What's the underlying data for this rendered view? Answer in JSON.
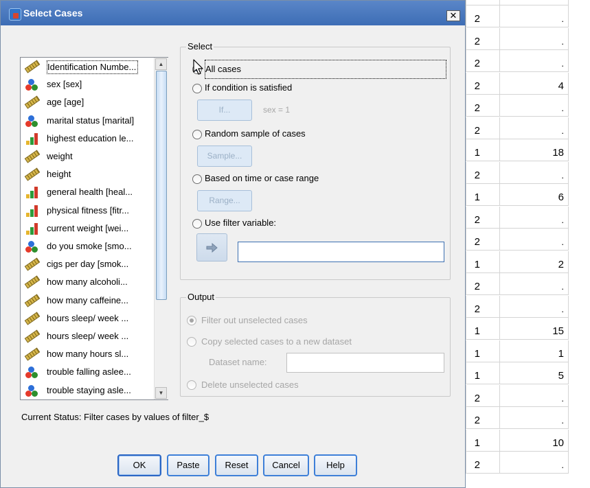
{
  "window": {
    "title": "Select Cases",
    "close_glyph": "✕"
  },
  "variables": [
    {
      "label": "Identification Numbe...",
      "icon": "scale-icon"
    },
    {
      "label": "sex [sex]",
      "icon": "nominal-icon"
    },
    {
      "label": "age [age]",
      "icon": "scale-icon"
    },
    {
      "label": "marital status [marital]",
      "icon": "nominal-icon"
    },
    {
      "label": "highest education le...",
      "icon": "ordinal-icon"
    },
    {
      "label": "weight",
      "icon": "scale-icon"
    },
    {
      "label": "height",
      "icon": "scale-icon"
    },
    {
      "label": "general health [heal...",
      "icon": "ordinal-icon"
    },
    {
      "label": "physical fitness [fitr...",
      "icon": "ordinal-icon"
    },
    {
      "label": "current weight [wei...",
      "icon": "ordinal-icon"
    },
    {
      "label": "do you smoke [smo...",
      "icon": "nominal-icon"
    },
    {
      "label": "cigs per day  [smok...",
      "icon": "scale-icon"
    },
    {
      "label": "how  many alcoholi...",
      "icon": "scale-icon"
    },
    {
      "label": "how many caffeine...",
      "icon": "scale-icon"
    },
    {
      "label": "hours sleep/ week ...",
      "icon": "scale-icon"
    },
    {
      "label": "hours sleep/ week ...",
      "icon": "scale-icon"
    },
    {
      "label": "how many hours sl...",
      "icon": "scale-icon"
    },
    {
      "label": "trouble falling aslee...",
      "icon": "nominal-icon"
    },
    {
      "label": "trouble staying asle...",
      "icon": "nominal-icon"
    }
  ],
  "select": {
    "group_title": "Select",
    "all_cases": "All cases",
    "if_condition": "If condition is satisfied",
    "if_button": "If...",
    "if_expression": "sex = 1",
    "random_sample": "Random sample of cases",
    "sample_button": "Sample...",
    "based_on_time": "Based on time or case range",
    "range_button": "Range...",
    "use_filter": "Use filter variable:",
    "filter_value": "",
    "selected_option": "All cases"
  },
  "output": {
    "group_title": "Output",
    "filter_out": "Filter out unselected cases",
    "copy_selected": "Copy selected cases to a new dataset",
    "dataset_name_label": "Dataset name:",
    "dataset_name_value": "",
    "delete_unselected": "Delete unselected cases"
  },
  "status": "Current Status: Filter cases by values of filter_$",
  "buttons": {
    "ok": "OK",
    "paste": "Paste",
    "reset": "Reset",
    "cancel": "Cancel",
    "help": "Help"
  },
  "sheet_rows": [
    {
      "a": "2",
      "b": "."
    },
    {
      "a": "2",
      "b": "."
    },
    {
      "a": "2",
      "b": "."
    },
    {
      "a": "2",
      "b": "4"
    },
    {
      "a": "2",
      "b": "."
    },
    {
      "a": "2",
      "b": "."
    },
    {
      "a": "1",
      "b": "18"
    },
    {
      "a": "2",
      "b": "."
    },
    {
      "a": "1",
      "b": "6"
    },
    {
      "a": "2",
      "b": "."
    },
    {
      "a": "2",
      "b": "."
    },
    {
      "a": "1",
      "b": "2"
    },
    {
      "a": "2",
      "b": "."
    },
    {
      "a": "2",
      "b": "."
    },
    {
      "a": "1",
      "b": "15"
    },
    {
      "a": "1",
      "b": "1"
    },
    {
      "a": "1",
      "b": "5"
    },
    {
      "a": "2",
      "b": "."
    },
    {
      "a": "2",
      "b": "."
    },
    {
      "a": "1",
      "b": "10"
    },
    {
      "a": "2",
      "b": "."
    }
  ],
  "colors": {
    "titlebar": "#3d6db5",
    "dialog_bg": "#f0f0f0",
    "button_border": "#3d7fd8"
  }
}
